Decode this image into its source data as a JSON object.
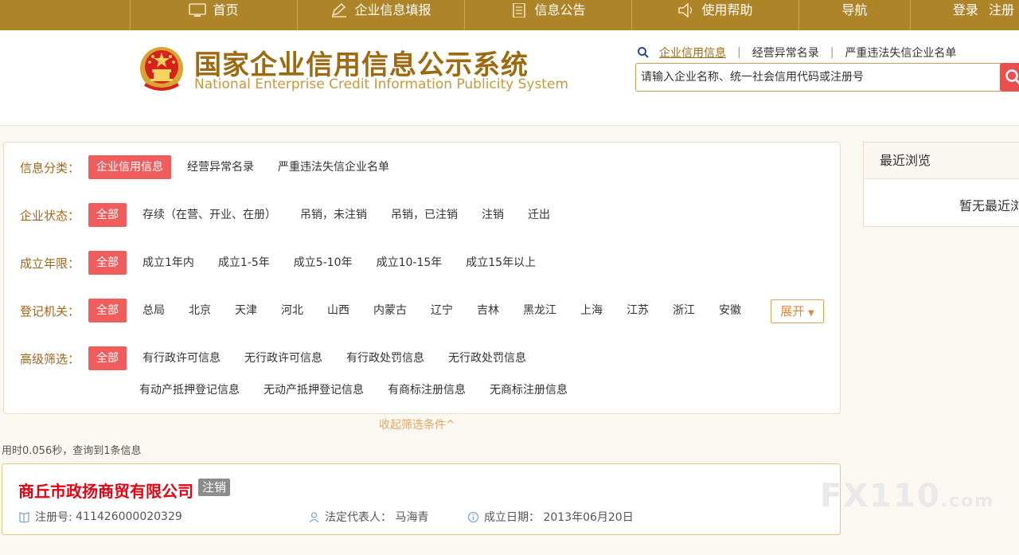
{
  "topnav": {
    "items": [
      {
        "label": "首页",
        "icon": "monitor-icon"
      },
      {
        "label": "企业信息填报",
        "icon": "edit-icon"
      },
      {
        "label": "信息公告",
        "icon": "document-icon"
      },
      {
        "label": "使用帮助",
        "icon": "speaker-icon"
      },
      {
        "label": "导航",
        "icon": ""
      }
    ],
    "login": "登录",
    "register": "注册"
  },
  "header": {
    "title_cn": "国家企业信用信息公示系统",
    "title_en": "National Enterprise Credit Information Publicity System"
  },
  "search": {
    "tabs": [
      "企业信用信息",
      "经营异常名录",
      "严重违法失信企业名单"
    ],
    "active_tab": "企业信用信息",
    "placeholder": "请输入企业名称、统一社会信用代码或注册号"
  },
  "filters": {
    "category": {
      "label": "信息分类：",
      "options": [
        "企业信用信息",
        "经营异常名录",
        "严重违法失信企业名单"
      ]
    },
    "status": {
      "label": "企业状态：",
      "options": [
        "全部",
        "存续（在营、开业、在册）",
        "吊销，未注销",
        "吊销，已注销",
        "注销",
        "迁出"
      ]
    },
    "years": {
      "label": "成立年限：",
      "options": [
        "全部",
        "成立1年内",
        "成立1-5年",
        "成立5-10年",
        "成立10-15年",
        "成立15年以上"
      ]
    },
    "authority": {
      "label": "登记机关：",
      "options": [
        "全部",
        "总局",
        "北京",
        "天津",
        "河北",
        "山西",
        "内蒙古",
        "辽宁",
        "吉林",
        "黑龙江",
        "上海",
        "江苏",
        "浙江",
        "安徽"
      ]
    },
    "advanced": {
      "label": "高级筛选：",
      "options": [
        "全部",
        "有行政许可信息",
        "无行政许可信息",
        "有行政处罚信息",
        "无行政处罚信息"
      ],
      "options_row2": [
        "有动产抵押登记信息",
        "无动产抵押登记信息",
        "有商标注册信息",
        "无商标注册信息"
      ]
    },
    "expand_label": "展开",
    "collapse_label": "收起筛选条件^"
  },
  "result_info": "用时0.056秒，查询到1条信息",
  "result": {
    "company_name": "商丘市政扬商贸有限公司",
    "status_badge": "注销",
    "reg_no_label": "注册号:",
    "reg_no": "411426000020329",
    "legal_rep_label": "法定代表人：",
    "legal_rep": "马海青",
    "est_date_label": "成立日期：",
    "est_date": "2013年06月20日"
  },
  "sidebar": {
    "title": "最近浏览",
    "empty_text": "暂无最近浏"
  },
  "watermark": {
    "main": "FX110",
    "suffix": ".com"
  },
  "colors": {
    "nav_bg": "#ae8429",
    "title_brown": "#9c6b11",
    "active_red": "#ef5d5d",
    "company_red": "#e60012",
    "label_brown": "#a0661a"
  }
}
